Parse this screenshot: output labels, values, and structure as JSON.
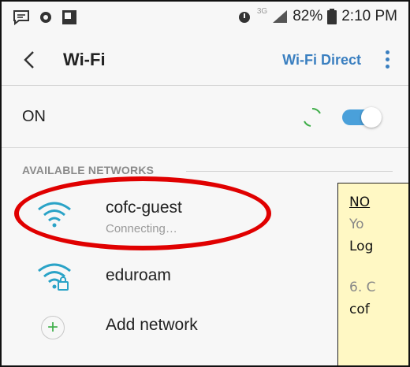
{
  "statusbar": {
    "network_type": "3G",
    "battery": "82%",
    "time": "2:10 PM"
  },
  "header": {
    "title": "Wi-Fi",
    "wifi_direct_label": "Wi-Fi Direct"
  },
  "wifi_toggle": {
    "label": "ON",
    "state": "on",
    "accent_color": "#4aa0da"
  },
  "section_header": "AVAILABLE NETWORKS",
  "networks": [
    {
      "name": "cofc-guest",
      "status": "Connecting…",
      "icon": "wifi-icon",
      "secured": false
    },
    {
      "name": "eduroam",
      "status": "",
      "icon": "wifi-lock-icon",
      "secured": true
    }
  ],
  "add_network_label": "Add network",
  "note": {
    "line1": "NO",
    "line2": "Yo",
    "line3": "Log",
    "line4": "6. C",
    "line5": "cof"
  },
  "colors": {
    "link_blue": "#3a7fc0",
    "highlight_red": "#e00000",
    "note_bg": "#fff8c4",
    "wifi_teal": "#2aa3c7"
  }
}
